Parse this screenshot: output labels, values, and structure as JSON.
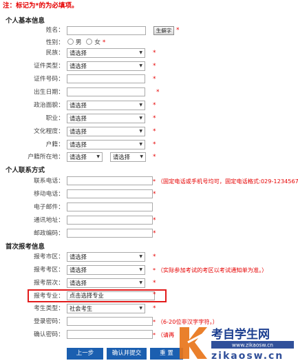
{
  "notice": "注：标记为*的为必填项。",
  "sections": {
    "personal": "个人基本信息",
    "contact": "个人联系方式",
    "exam": "首次报考信息"
  },
  "personal": {
    "name_label": "姓名：",
    "rare_char_button": "生僻字",
    "gender_label": "性别：",
    "male": "男",
    "female": "女",
    "ethnicity_label": "民族：",
    "idtype_label": "证件类型：",
    "idnum_label": "证件号码：",
    "birth_label": "出生日期：",
    "political_label": "政治面貌：",
    "job_label": "职业：",
    "edu_label": "文化程度：",
    "hukou_label": "户籍：",
    "hukouloc_label": "户籍所在地："
  },
  "contact": {
    "phone_label": "联系电话：",
    "phone_hint": "（固定电话或手机号均可，固定电话格式:029-12345678。）",
    "mobile_label": "移动电话：",
    "email_label": "电子邮件：",
    "address_label": "通讯地址：",
    "zip_label": "邮政编码："
  },
  "exam": {
    "city_label": "报考市区：",
    "district_label": "报考考区：",
    "district_hint": "（实际参加考试的考区以考试通知单为准。）",
    "level_label": "报考层次：",
    "major_label": "报考专业：",
    "major_value": "点击选择专业",
    "type_label": "考生类型：",
    "type_value": "社会考生",
    "pwd_label": "登录密码：",
    "pwd_hint": "（6-20位非汉字字符。）",
    "confirm_label": "确认密码：",
    "confirm_hint": "（请再"
  },
  "select_placeholder": "请选择",
  "required_mark": "*",
  "buttons": {
    "prev": "上一步",
    "submit": "确认并提交",
    "reset": "重 置"
  },
  "watermark": {
    "brand": "考自学生网",
    "url": "www.zikaosw.cn",
    "pinyin": "zikaosw.cn"
  }
}
